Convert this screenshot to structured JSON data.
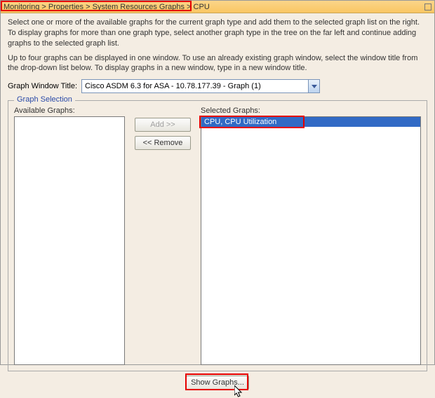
{
  "titlebar": {
    "breadcrumb": "Monitoring > Properties > System Resources Graphs > CPU"
  },
  "intro": {
    "p1": "Select one or more of the available graphs for the current graph type and add them to the selected graph list on the right. To display graphs for more than one graph type, select another graph type in the tree on the far left and continue adding graphs to the selected graph list.",
    "p2": "Up to four graphs can be displayed in one window. To use an already existing graph window, select the window title from the drop-down list below. To display graphs in a new window, type in a new window title."
  },
  "window_title": {
    "label": "Graph Window Title:",
    "value": "Cisco ASDM 6.3 for ASA - 10.78.177.39 - Graph (1)"
  },
  "graph_selection": {
    "legend": "Graph Selection",
    "available_label": "Available Graphs:",
    "selected_label": "Selected Graphs:",
    "add_label": "Add >>",
    "remove_label": "<< Remove",
    "available_items": [],
    "selected_items": [
      "CPU, CPU Utilization"
    ]
  },
  "footer": {
    "show_graphs": "Show Graphs..."
  }
}
